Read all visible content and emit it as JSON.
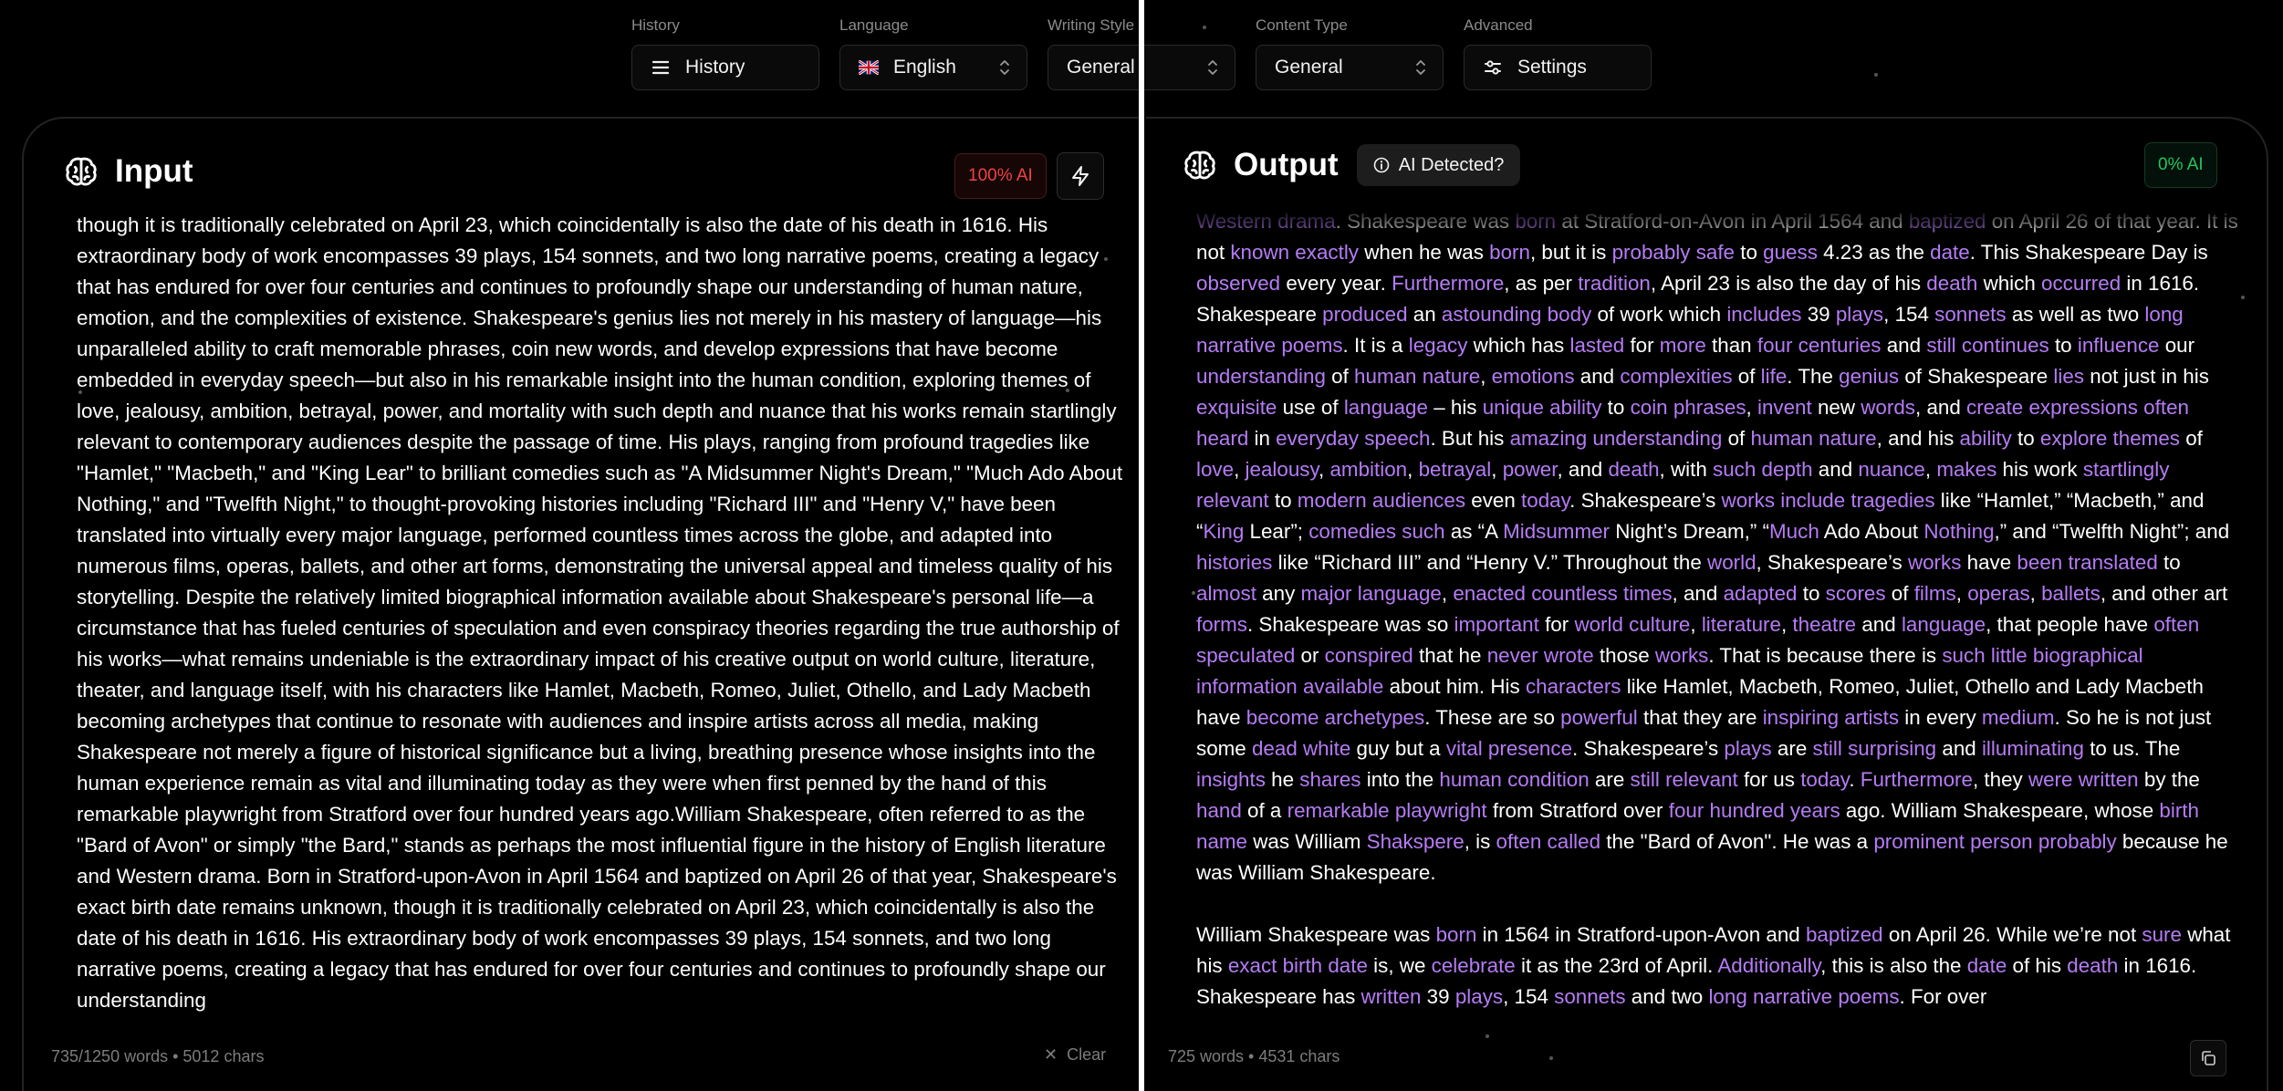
{
  "toolbar": {
    "history": {
      "label": "History",
      "value": "History",
      "icon": "menu-icon"
    },
    "language": {
      "label": "Language",
      "value": "English",
      "icon": "uk-flag-icon"
    },
    "writing_style": {
      "label": "Writing Style",
      "value": "General"
    },
    "content_type": {
      "label": "Content Type",
      "value": "General"
    },
    "advanced": {
      "label": "Advanced",
      "value": "Settings",
      "icon": "sliders-icon"
    }
  },
  "input": {
    "title": "Input",
    "ai_badge": "100% AI",
    "footer": "735/1250 words • 5012 chars",
    "clear_label": "Clear",
    "text": "though it is traditionally celebrated on April 23, which coincidentally is also the date of his death in 1616. His extraordinary body of work encompasses 39 plays, 154 sonnets, and two long narrative poems, creating a legacy that has endured for over four centuries and continues to profoundly shape our understanding of human nature, emotion, and the complexities of existence. Shakespeare's genius lies not merely in his mastery of language—his unparalleled ability to craft memorable phrases, coin new words, and develop expressions that have become embedded in everyday speech—but also in his remarkable insight into the human condition, exploring themes of love, jealousy, ambition, betrayal, power, and mortality with such depth and nuance that his works remain startlingly relevant to contemporary audiences despite the passage of time. His plays, ranging from profound tragedies like \"Hamlet,\" \"Macbeth,\" and \"King Lear\" to brilliant comedies such as \"A Midsummer Night's Dream,\" \"Much Ado About Nothing,\" and \"Twelfth Night,\" to thought-provoking histories including \"Richard III\" and \"Henry V,\" have been translated into virtually every major language, performed countless times across the globe, and adapted into numerous films, operas, ballets, and other art forms, demonstrating the universal appeal and timeless quality of his storytelling. Despite the relatively limited biographical information available about Shakespeare's personal life—a circumstance that has fueled centuries of speculation and even conspiracy theories regarding the true authorship of his works—what remains undeniable is the extraordinary impact of his creative output on world culture, literature, theater, and language itself, with his characters like Hamlet, Macbeth, Romeo, Juliet, Othello, and Lady Macbeth becoming archetypes that continue to resonate with audiences and inspire artists across all media, making Shakespeare not merely a figure of historical significance but a living, breathing presence whose insights into the human experience remain as vital and illuminating today as they were when first penned by the hand of this remarkable playwright from Stratford over four hundred years ago.William Shakespeare, often referred to as the \"Bard of Avon\" or simply \"the Bard,\" stands as perhaps the most influential figure in the history of English literature and Western drama. Born in Stratford-upon-Avon in April 1564 and baptized on April 26 of that year, Shakespeare's exact birth date remains unknown, though it is traditionally celebrated on April 23, which coincidentally is also the date of his death in 1616. His extraordinary body of work encompasses 39 plays, 154 sonnets, and two long narrative poems, creating a legacy that has endured for over four centuries and continues to profoundly shape our understanding"
  },
  "output": {
    "title": "Output",
    "detect_button": "AI Detected?",
    "ai_badge": "0% AI",
    "footer": "725 words • 4531 chars",
    "paragraphs": [
      [
        [
          "Western drama",
          true
        ],
        [
          ". Shakespeare was ",
          false
        ],
        [
          "born",
          true
        ],
        [
          " at Stratford-on-Avon in April 1564 and ",
          false
        ],
        [
          "baptized",
          true
        ],
        [
          " on April 26 of that year. It is not ",
          false
        ],
        [
          "known exactly",
          true
        ],
        [
          " when he was ",
          false
        ],
        [
          "born",
          true
        ],
        [
          ", but it is ",
          false
        ],
        [
          "probably safe",
          true
        ],
        [
          " to ",
          false
        ],
        [
          "guess",
          true
        ],
        [
          " 4.23 as the ",
          false
        ],
        [
          "date",
          true
        ],
        [
          ". This Shakespeare Day is ",
          false
        ],
        [
          "observed",
          true
        ],
        [
          " every year. ",
          false
        ],
        [
          "Furthermore",
          true
        ],
        [
          ", as per ",
          false
        ],
        [
          "tradition",
          true
        ],
        [
          ", April 23 is also the day of his ",
          false
        ],
        [
          "death",
          true
        ],
        [
          " which ",
          false
        ],
        [
          "occurred",
          true
        ],
        [
          " in 1616. Shakespeare ",
          false
        ],
        [
          "produced",
          true
        ],
        [
          " an ",
          false
        ],
        [
          "astounding body",
          true
        ],
        [
          " of work which ",
          false
        ],
        [
          "includes",
          true
        ],
        [
          " 39 ",
          false
        ],
        [
          "plays",
          true
        ],
        [
          ", 154 ",
          false
        ],
        [
          "sonnets",
          true
        ],
        [
          " as well as two ",
          false
        ],
        [
          "long narrative poems",
          true
        ],
        [
          ". It is a ",
          false
        ],
        [
          "legacy",
          true
        ],
        [
          " which has ",
          false
        ],
        [
          "lasted",
          true
        ],
        [
          " for ",
          false
        ],
        [
          "more",
          true
        ],
        [
          " than ",
          false
        ],
        [
          "four centuries",
          true
        ],
        [
          " and ",
          false
        ],
        [
          "still continues",
          true
        ],
        [
          " to ",
          false
        ],
        [
          "influence",
          true
        ],
        [
          " our ",
          false
        ],
        [
          "understanding",
          true
        ],
        [
          " of ",
          false
        ],
        [
          "human nature",
          true
        ],
        [
          ", ",
          false
        ],
        [
          "emotions",
          true
        ],
        [
          " and ",
          false
        ],
        [
          "complexities",
          true
        ],
        [
          " of ",
          false
        ],
        [
          "life",
          true
        ],
        [
          ". The ",
          false
        ],
        [
          "genius",
          true
        ],
        [
          " of Shakespeare ",
          false
        ],
        [
          "lies",
          true
        ],
        [
          " not just in his ",
          false
        ],
        [
          "exquisite",
          true
        ],
        [
          " use of ",
          false
        ],
        [
          "language",
          true
        ],
        [
          " – his ",
          false
        ],
        [
          "unique ability",
          true
        ],
        [
          " to ",
          false
        ],
        [
          "coin phrases",
          true
        ],
        [
          ", ",
          false
        ],
        [
          "invent",
          true
        ],
        [
          " new ",
          false
        ],
        [
          "words",
          true
        ],
        [
          ", and ",
          false
        ],
        [
          "create expressions often heard",
          true
        ],
        [
          " in ",
          false
        ],
        [
          "everyday speech",
          true
        ],
        [
          ". But his ",
          false
        ],
        [
          "amazing understanding",
          true
        ],
        [
          " of ",
          false
        ],
        [
          "human nature",
          true
        ],
        [
          ", and his ",
          false
        ],
        [
          "ability",
          true
        ],
        [
          " to ",
          false
        ],
        [
          "explore themes",
          true
        ],
        [
          " of ",
          false
        ],
        [
          "love",
          true
        ],
        [
          ", ",
          false
        ],
        [
          "jealousy",
          true
        ],
        [
          ", ",
          false
        ],
        [
          "ambition",
          true
        ],
        [
          ", ",
          false
        ],
        [
          "betrayal",
          true
        ],
        [
          ", ",
          false
        ],
        [
          "power",
          true
        ],
        [
          ", and ",
          false
        ],
        [
          "death",
          true
        ],
        [
          ", with ",
          false
        ],
        [
          "such depth",
          true
        ],
        [
          " and ",
          false
        ],
        [
          "nuance",
          true
        ],
        [
          ", ",
          false
        ],
        [
          "makes",
          true
        ],
        [
          " his work ",
          false
        ],
        [
          "startlingly relevant",
          true
        ],
        [
          " to ",
          false
        ],
        [
          "modern audiences",
          true
        ],
        [
          " even ",
          false
        ],
        [
          "today",
          true
        ],
        [
          ". Shakespeare’s ",
          false
        ],
        [
          "works include tragedies",
          true
        ],
        [
          " like “Hamlet,” “Macbeth,” and “",
          false
        ],
        [
          "King",
          true
        ],
        [
          " Lear”; ",
          false
        ],
        [
          "comedies such",
          true
        ],
        [
          " as “A ",
          false
        ],
        [
          "Midsummer",
          true
        ],
        [
          " Night’s Dream,” “",
          false
        ],
        [
          "Much",
          true
        ],
        [
          " Ado About ",
          false
        ],
        [
          "Nothing",
          true
        ],
        [
          ",” and “Twelfth Night”; and ",
          false
        ],
        [
          "histories",
          true
        ],
        [
          " like “Richard III” and “Henry V.” Throughout the ",
          false
        ],
        [
          "world",
          true
        ],
        [
          ", Shakespeare’s ",
          false
        ],
        [
          "works",
          true
        ],
        [
          " have ",
          false
        ],
        [
          "been translated",
          true
        ],
        [
          " to ",
          false
        ],
        [
          "almost",
          true
        ],
        [
          " any ",
          false
        ],
        [
          "major language",
          true
        ],
        [
          ", ",
          false
        ],
        [
          "enacted countless times",
          true
        ],
        [
          ", and ",
          false
        ],
        [
          "adapted",
          true
        ],
        [
          " to ",
          false
        ],
        [
          "scores",
          true
        ],
        [
          " of ",
          false
        ],
        [
          "films",
          true
        ],
        [
          ", ",
          false
        ],
        [
          "operas",
          true
        ],
        [
          ", ",
          false
        ],
        [
          "ballets",
          true
        ],
        [
          ", and other art ",
          false
        ],
        [
          "forms",
          true
        ],
        [
          ". Shakespeare was so ",
          false
        ],
        [
          "important",
          true
        ],
        [
          " for ",
          false
        ],
        [
          "world culture",
          true
        ],
        [
          ", ",
          false
        ],
        [
          "literature",
          true
        ],
        [
          ", ",
          false
        ],
        [
          "theatre",
          true
        ],
        [
          " and ",
          false
        ],
        [
          "language",
          true
        ],
        [
          ", that people have ",
          false
        ],
        [
          "often speculated",
          true
        ],
        [
          " or ",
          false
        ],
        [
          "conspired",
          true
        ],
        [
          " that he ",
          false
        ],
        [
          "never wrote",
          true
        ],
        [
          " those ",
          false
        ],
        [
          "works",
          true
        ],
        [
          ". That is because there is ",
          false
        ],
        [
          "such little biographical information available",
          true
        ],
        [
          " about him. His ",
          false
        ],
        [
          "characters",
          true
        ],
        [
          " like Hamlet, Macbeth, Romeo, Juliet, Othello and Lady Macbeth have ",
          false
        ],
        [
          "become archetypes",
          true
        ],
        [
          ". These are so ",
          false
        ],
        [
          "powerful",
          true
        ],
        [
          " that they are ",
          false
        ],
        [
          "inspiring artists",
          true
        ],
        [
          " in every ",
          false
        ],
        [
          "medium",
          true
        ],
        [
          ". So he is not just some ",
          false
        ],
        [
          "dead white",
          true
        ],
        [
          " guy but a ",
          false
        ],
        [
          "vital presence",
          true
        ],
        [
          ". Shakespeare’s ",
          false
        ],
        [
          "plays",
          true
        ],
        [
          " are ",
          false
        ],
        [
          "still surprising",
          true
        ],
        [
          " and ",
          false
        ],
        [
          "illuminating",
          true
        ],
        [
          " to us. The ",
          false
        ],
        [
          "insights",
          true
        ],
        [
          " he ",
          false
        ],
        [
          "shares",
          true
        ],
        [
          " into the ",
          false
        ],
        [
          "human condition",
          true
        ],
        [
          " are ",
          false
        ],
        [
          "still relevant",
          true
        ],
        [
          " for us ",
          false
        ],
        [
          "today",
          true
        ],
        [
          ". ",
          false
        ],
        [
          "Furthermore",
          true
        ],
        [
          ", they ",
          false
        ],
        [
          "were written",
          true
        ],
        [
          " by the ",
          false
        ],
        [
          "hand",
          true
        ],
        [
          " of a ",
          false
        ],
        [
          "remarkable playwright",
          true
        ],
        [
          " from Stratford over ",
          false
        ],
        [
          "four hundred years",
          true
        ],
        [
          " ago. William Shakespeare, whose ",
          false
        ],
        [
          "birth name",
          true
        ],
        [
          " was William ",
          false
        ],
        [
          "Shakspere",
          true
        ],
        [
          ", is ",
          false
        ],
        [
          "often called",
          true
        ],
        [
          " the \"Bard of Avon\". He was a ",
          false
        ],
        [
          "prominent person probably",
          true
        ],
        [
          " because he was William Shakespeare.",
          false
        ]
      ],
      [
        [
          " William Shakespeare was ",
          false
        ],
        [
          "born",
          true
        ],
        [
          " in 1564 in Stratford-upon-Avon and ",
          false
        ],
        [
          "baptized",
          true
        ],
        [
          " on April 26. While we’re not ",
          false
        ],
        [
          "sure",
          true
        ],
        [
          " what his ",
          false
        ],
        [
          "exact birth date",
          true
        ],
        [
          " is, we ",
          false
        ],
        [
          "celebrate",
          true
        ],
        [
          " it as the 23rd of April. ",
          false
        ],
        [
          "Additionally",
          true
        ],
        [
          ", this is also the ",
          false
        ],
        [
          "date",
          true
        ],
        [
          " of his ",
          false
        ],
        [
          "death",
          true
        ],
        [
          " in 1616. Shakespeare has ",
          false
        ],
        [
          "written",
          true
        ],
        [
          " 39 ",
          false
        ],
        [
          "plays",
          true
        ],
        [
          ", 154 ",
          false
        ],
        [
          "sonnets",
          true
        ],
        [
          " and two ",
          false
        ],
        [
          "long narrative poems",
          true
        ],
        [
          ". For over",
          false
        ]
      ]
    ]
  },
  "colors": {
    "highlight": "#b57cf5",
    "ai_red": "#ef4444",
    "ai_green": "#22c55e"
  }
}
